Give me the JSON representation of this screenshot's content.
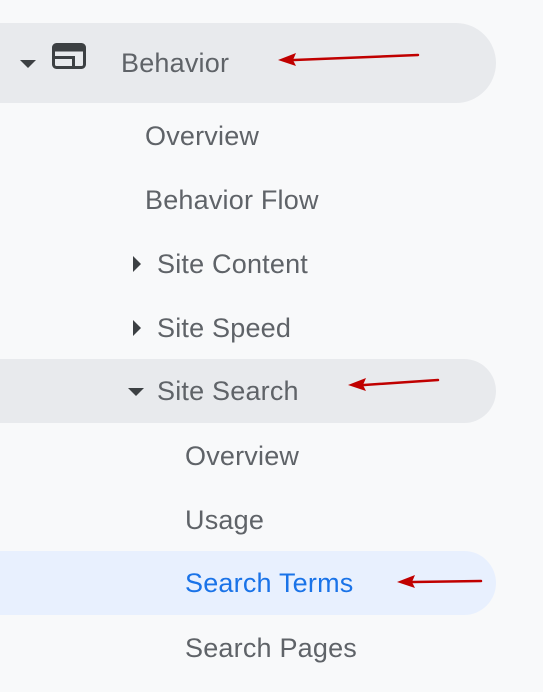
{
  "nav": {
    "behavior": {
      "label": "Behavior",
      "icon": "behavior-layout-icon",
      "expanded": true
    },
    "items": {
      "overview": "Overview",
      "behavior_flow": "Behavior Flow",
      "site_content": "Site Content",
      "site_speed": "Site Speed"
    },
    "site_search": {
      "label": "Site Search",
      "expanded": true,
      "children": {
        "overview": "Overview",
        "usage": "Usage",
        "search_terms": "Search Terms",
        "search_pages": "Search Pages"
      },
      "selected": "Search Terms"
    }
  },
  "annotations": {
    "arrow_color": "#c00000"
  },
  "colors": {
    "background": "#f8f9fa",
    "shaded_row": "#e8eaed",
    "active_row": "#e8f0fe",
    "active_text": "#1a73e8",
    "text": "#5f6368"
  }
}
